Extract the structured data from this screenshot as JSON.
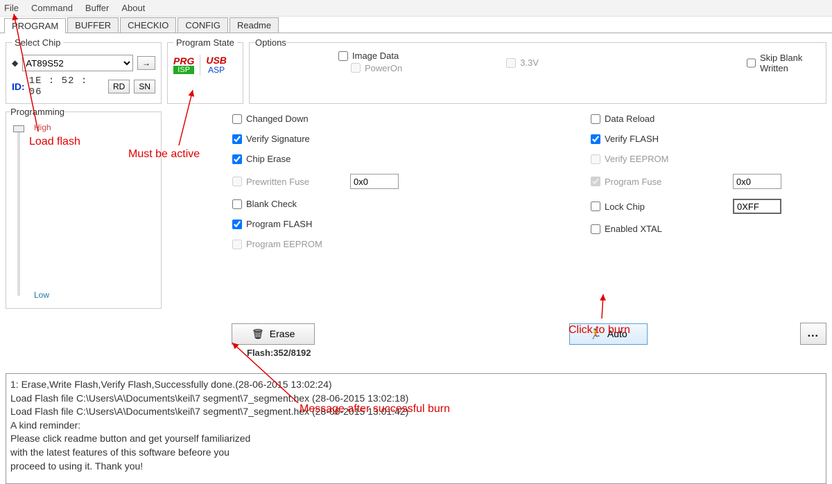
{
  "menu": [
    "File",
    "Command",
    "Buffer",
    "About"
  ],
  "tabs": [
    "PROGRAM",
    "BUFFER",
    "CHECKIO",
    "CONFIG",
    "Readme"
  ],
  "active_tab": 0,
  "groups": {
    "select_chip": "Select Chip",
    "program_state": "Program State",
    "options": "Options",
    "programming": "Programming"
  },
  "chip": {
    "selected": "AT89S52",
    "id_label": "ID:",
    "id": "1E : 52 : 06",
    "rd": "RD",
    "sn": "SN",
    "arrow": "→"
  },
  "prg_state": {
    "prg": "PRG",
    "isp": "ISP",
    "usb": "USB",
    "asp": "ASP"
  },
  "top_opts": {
    "image_data": "Image Data",
    "power_on": "PowerOn",
    "v33": "3.3V",
    "skip_blank": "Skip Blank Written"
  },
  "prog_slider": {
    "high": "High",
    "low": "Low"
  },
  "left_opts": {
    "changed_down": "Changed Down",
    "verify_sig": "Verify Signature",
    "chip_erase": "Chip Erase",
    "prewritten_fuse": "Prewritten Fuse",
    "fuse_val": "0x0",
    "blank_check": "Blank Check",
    "program_flash": "Program FLASH",
    "program_eeprom": "Program EEPROM"
  },
  "right_opts": {
    "data_reload": "Data Reload",
    "verify_flash": "Verify FLASH",
    "verify_eeprom": "Verify EEPROM",
    "program_fuse": "Program Fuse",
    "fuse_val": "0x0",
    "lock_chip": "Lock Chip",
    "lock_val": "0XFF",
    "enabled_xtal": "Enabled XTAL"
  },
  "buttons": {
    "erase": "Erase",
    "auto": "Auto",
    "more": "..."
  },
  "flash_status": "Flash:352/8192",
  "log_lines": [
    "1: Erase,Write Flash,Verify Flash,Successfully done.(28-06-2015 13:02:24)",
    "Load Flash file C:\\Users\\A\\Documents\\keil\\7 segment\\7_segment.hex (28-06-2015 13:02:18)",
    "Load Flash file C:\\Users\\A\\Documents\\keil\\7 segment\\7_segment.hex (28-06-2015 13:01:42)",
    "A kind reminder:",
    "Please click readme button and get yourself familiarized",
    "with the latest features of this software befeore you",
    "proceed to using it. Thank you!"
  ],
  "annotations": {
    "load_flash": "Load flash",
    "must_active": "Must be active",
    "click_burn": "Click to burn",
    "msg_success": "Message after successful burn"
  }
}
